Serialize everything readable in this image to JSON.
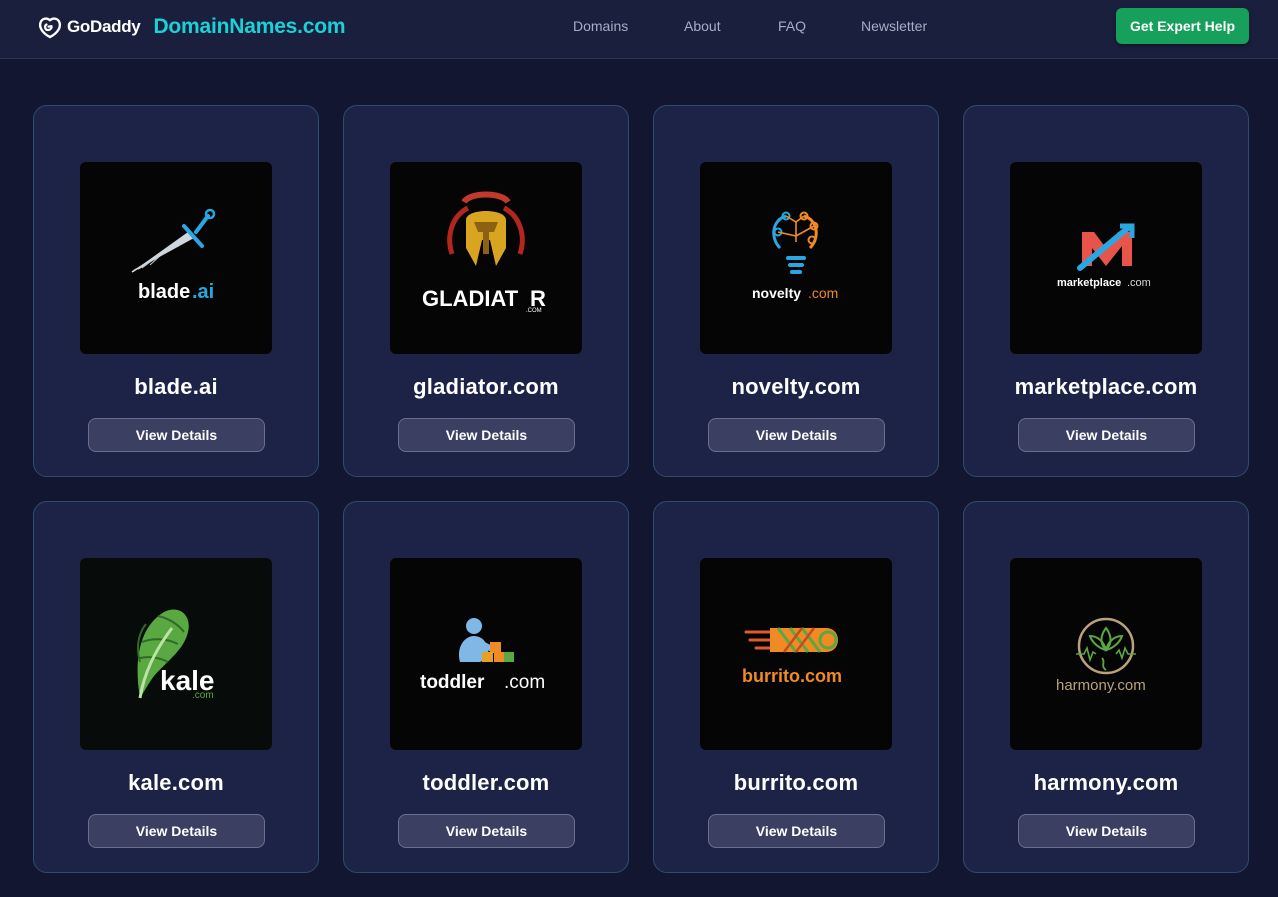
{
  "header": {
    "logo_text": "GoDaddy",
    "site_name": "DomainNames.com",
    "nav": [
      {
        "label": "Domains"
      },
      {
        "label": "About"
      },
      {
        "label": "FAQ"
      },
      {
        "label": "Newsletter"
      }
    ],
    "cta_label": "Get Expert Help"
  },
  "colors": {
    "page_bg": "#121631",
    "header_bg": "#1a1f3d",
    "card_bg": "#1d2346",
    "card_border": "#2e4d6e",
    "accent_cyan": "#1bd1d6",
    "cta_green": "#16a05c",
    "button_bg": "#3b4062"
  },
  "domains": [
    {
      "name": "blade.ai",
      "button": "View Details",
      "logo_word": "blade",
      "logo_suffix": ".ai",
      "logo_icon": "sword-icon"
    },
    {
      "name": "gladiator.com",
      "button": "View Details",
      "logo_word": "GLADIAT",
      "logo_word2": "R",
      "logo_suffix": ".COM",
      "logo_icon": "spartan-helmet-icon"
    },
    {
      "name": "novelty.com",
      "button": "View Details",
      "logo_word": "novelty",
      "logo_suffix": ".com",
      "logo_icon": "lightbulb-circuit-icon"
    },
    {
      "name": "marketplace.com",
      "button": "View Details",
      "logo_word": "marketplace",
      "logo_suffix": ".com",
      "logo_icon": "market-arrows-icon"
    },
    {
      "name": "kale.com",
      "button": "View Details",
      "logo_word": "kale",
      "logo_suffix": ".com",
      "logo_icon": "kale-leaf-icon"
    },
    {
      "name": "toddler.com",
      "button": "View Details",
      "logo_word": "toddler",
      "logo_suffix": ".com",
      "logo_icon": "toddler-blocks-icon"
    },
    {
      "name": "burrito.com",
      "button": "View Details",
      "logo_word": "burrito.com",
      "logo_suffix": "",
      "logo_icon": "burrito-icon"
    },
    {
      "name": "harmony.com",
      "button": "View Details",
      "logo_word": "harmony.com",
      "logo_suffix": "",
      "logo_icon": "lotus-circle-icon"
    }
  ]
}
